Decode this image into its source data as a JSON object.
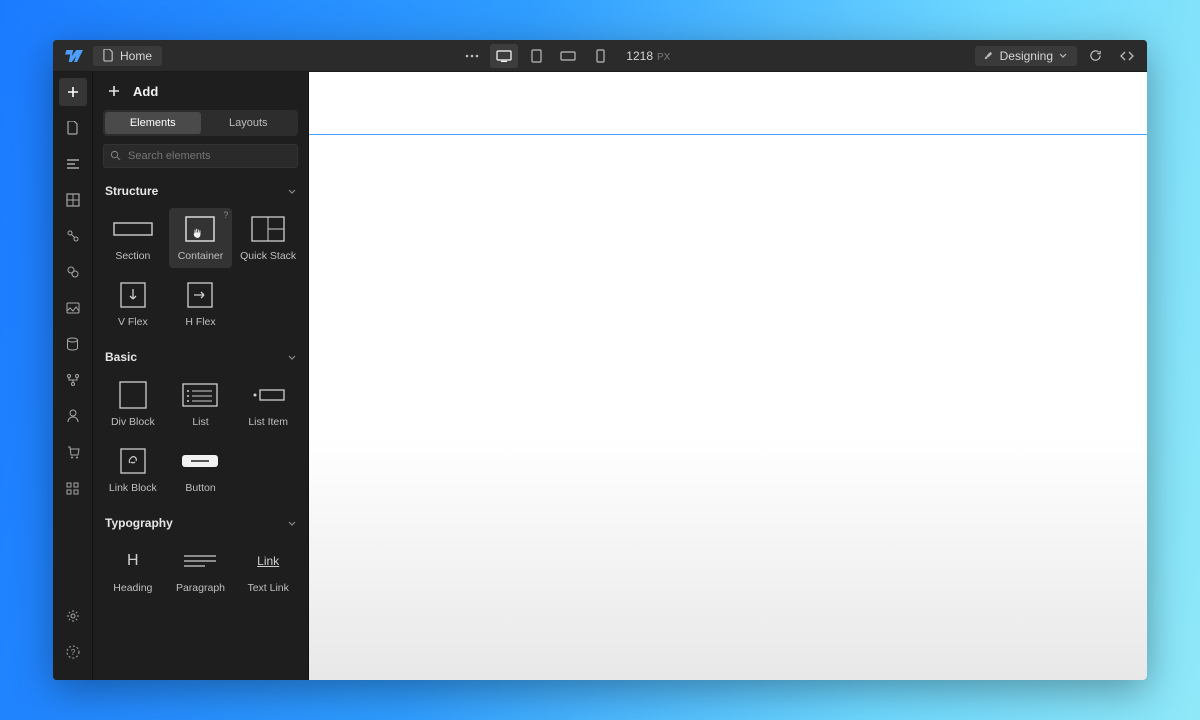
{
  "topbar": {
    "home_label": "Home",
    "width_value": "1218",
    "width_unit": "PX",
    "mode_label": "Designing"
  },
  "panel": {
    "title": "Add",
    "tabs": {
      "elements": "Elements",
      "layouts": "Layouts"
    },
    "search_placeholder": "Search elements"
  },
  "sections": {
    "structure": {
      "title": "Structure",
      "items": {
        "section": "Section",
        "container": "Container",
        "quick_stack": "Quick Stack",
        "v_flex": "V Flex",
        "h_flex": "H Flex"
      }
    },
    "basic": {
      "title": "Basic",
      "items": {
        "div_block": "Div Block",
        "list": "List",
        "list_item": "List Item",
        "link_block": "Link Block",
        "button": "Button"
      }
    },
    "typography": {
      "title": "Typography",
      "items": {
        "heading": "Heading",
        "paragraph": "Paragraph",
        "text_link": "Text Link"
      }
    }
  },
  "tooltip_mark": "?"
}
